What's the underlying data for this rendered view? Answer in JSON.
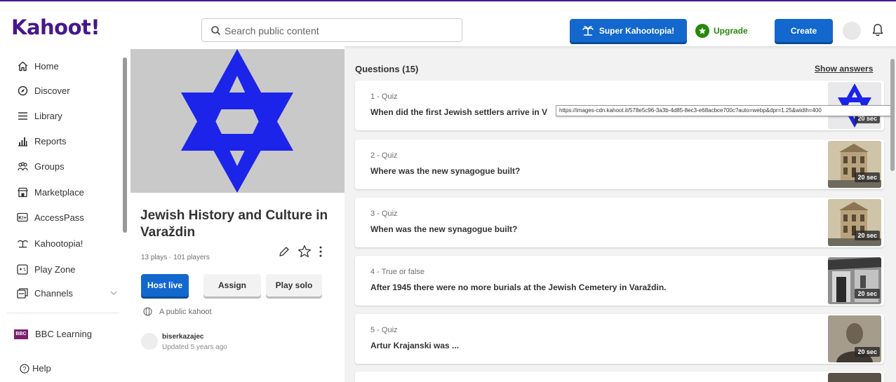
{
  "brand": {
    "logo": "Kahoot!",
    "primary": "#46178f",
    "blue": "#1368ce",
    "green": "#26890c"
  },
  "header": {
    "search_placeholder": "Search public content",
    "super_label": "Super Kahootopia!",
    "upgrade_label": "Upgrade",
    "create_label": "Create"
  },
  "sidebar": {
    "items": [
      {
        "label": "Home",
        "icon": "home-icon"
      },
      {
        "label": "Discover",
        "icon": "compass-icon"
      },
      {
        "label": "Library",
        "icon": "list-icon"
      },
      {
        "label": "Reports",
        "icon": "bar-chart-icon"
      },
      {
        "label": "Groups",
        "icon": "group-icon"
      },
      {
        "label": "Marketplace",
        "icon": "store-icon"
      },
      {
        "label": "AccessPass",
        "icon": "accesspass-icon"
      },
      {
        "label": "Kahootopia!",
        "icon": "island-icon"
      },
      {
        "label": "Play Zone",
        "icon": "game-icon"
      },
      {
        "label": "Channels",
        "icon": "channels-icon"
      }
    ],
    "channel": {
      "logo": "BBC",
      "label": "BBC Learning"
    },
    "help_label": "Help"
  },
  "kahoot": {
    "title": "Jewish History and Culture in Varaždin",
    "stats": "13 plays · 101 players",
    "host_label": "Host live",
    "assign_label": "Assign",
    "solo_label": "Play solo",
    "visibility": "A public kahoot",
    "creator": "biserkazajec",
    "updated": "Updated 5 years ago"
  },
  "questions": {
    "heading": "Questions (15)",
    "show_answers": "Show answers",
    "items": [
      {
        "type": "1 - Quiz",
        "text": "When did the first Jewish settlers arrive in V",
        "time": "20 sec",
        "thumb": "star-of-david"
      },
      {
        "type": "2 - Quiz",
        "text": "Where was the new synagogue built?",
        "time": "20 sec",
        "thumb": "synagogue-photo"
      },
      {
        "type": "3 - Quiz",
        "text": "When was the new synagogue built?",
        "time": "20 sec",
        "thumb": "synagogue-photo"
      },
      {
        "type": "4 - True or false",
        "text": "After 1945 there were no more burials at the Jewish Cemetery in Varaždin.",
        "time": "20 sec",
        "thumb": "building-photo"
      },
      {
        "type": "5 - Quiz",
        "text": "Artur Krajanski was ...",
        "time": "20 sec",
        "thumb": "portrait-photo"
      }
    ]
  },
  "tooltip": "https://images-cdn.kahoot.it/578e5c96-3a3b-4d85-8ec3-e68acbce700c?auto=webp&dpr=1.25&width=400"
}
